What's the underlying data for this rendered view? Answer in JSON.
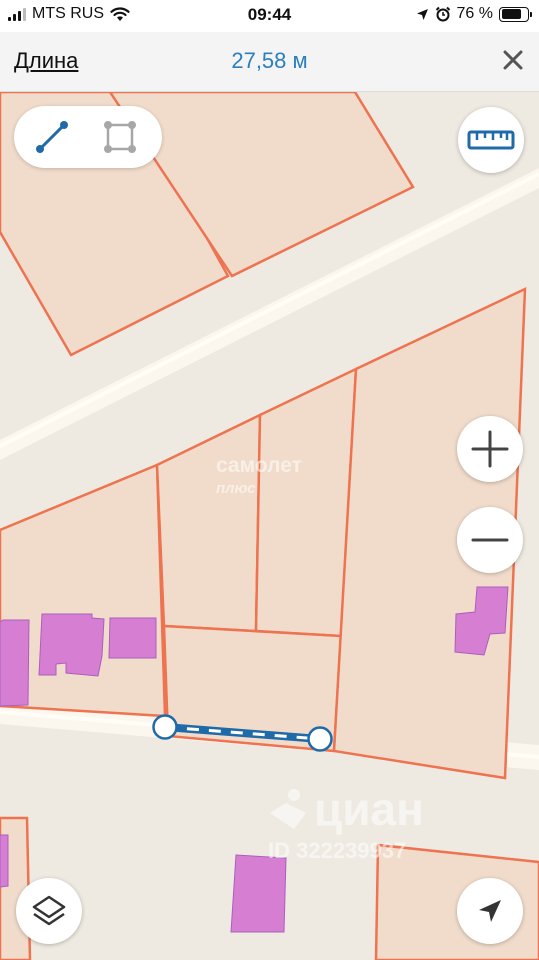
{
  "status_bar": {
    "carrier": "MTS RUS",
    "time": "09:44",
    "battery": "76 %",
    "battery_level": 0.76
  },
  "header": {
    "title": "Длина",
    "measurement": "27,58 м"
  },
  "watermarks": {
    "brand_line1": "самолет",
    "brand_line2": "плюс",
    "cian": "циан",
    "listing_id": "ID 322239937"
  },
  "icons": {
    "line_tool": "line-segment-icon",
    "area_tool": "polygon-icon",
    "ruler": "ruler-icon",
    "zoom_in": "plus-icon",
    "zoom_out": "minus-icon",
    "layers": "layers-icon",
    "locate": "navigation-arrow-icon",
    "close": "close-icon"
  },
  "colors": {
    "accent": "#2b7fbd",
    "parcel_border": "#ee7350",
    "parcel_fill": "#f1dccb",
    "building": "#d67fd2",
    "road": "#fbf7ee"
  }
}
